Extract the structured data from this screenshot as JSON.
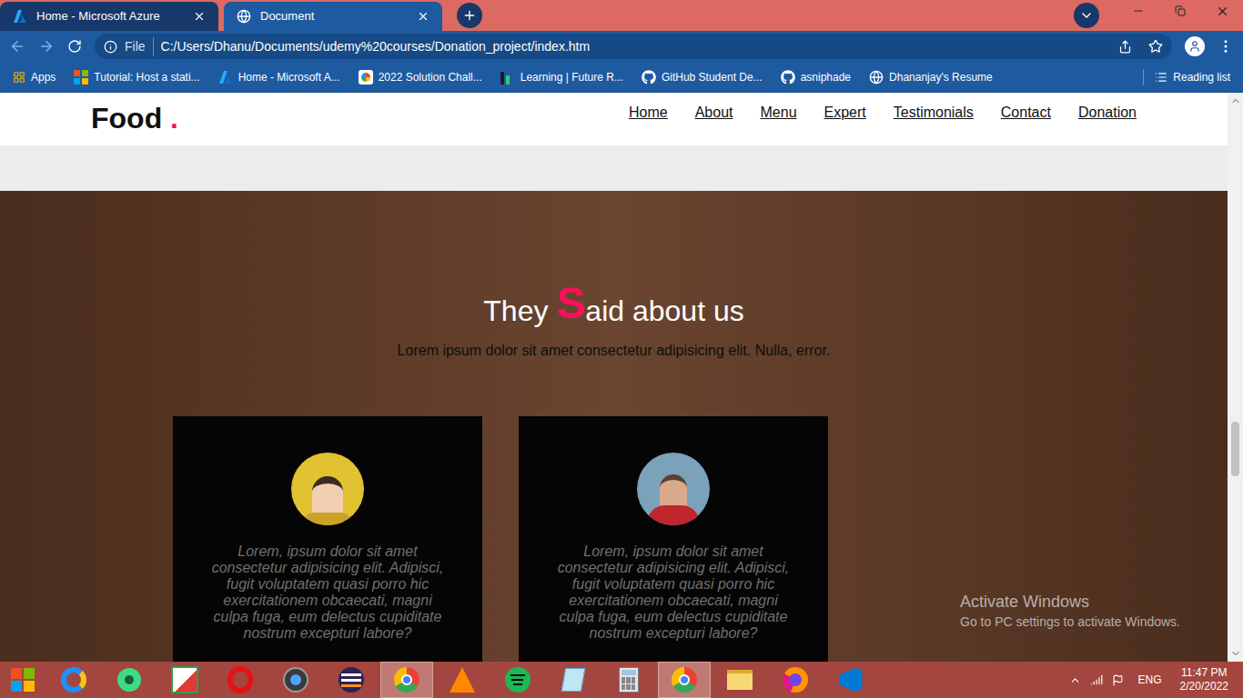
{
  "window": {
    "tabs": [
      {
        "title": "Home - Microsoft Azure",
        "kind": "azure",
        "selected": false
      },
      {
        "title": "Document",
        "kind": "globe",
        "selected": true
      }
    ]
  },
  "address_bar": {
    "scheme": "File",
    "url": "C:/Users/Dhanu/Documents/udemy%20courses/Donation_project/index.htm"
  },
  "bookmarks": {
    "apps": "Apps",
    "items": [
      {
        "label": "Tutorial: Host a stati...",
        "kind": "windows"
      },
      {
        "label": "Home - Microsoft A...",
        "kind": "azure"
      },
      {
        "label": "2022 Solution Chall...",
        "kind": "google"
      },
      {
        "label": "Learning | Future R...",
        "kind": "learning"
      },
      {
        "label": "GitHub Student De...",
        "kind": "github"
      },
      {
        "label": "asniphade",
        "kind": "github"
      },
      {
        "label": "Dhananjay's Resume",
        "kind": "globe"
      }
    ],
    "reading_list": "Reading list"
  },
  "page": {
    "logo": {
      "text": "Food",
      "accent": "."
    },
    "nav": [
      "Home",
      "About",
      "Menu",
      "Expert",
      "Testimonials",
      "Contact",
      "Donation"
    ],
    "section": {
      "title_before": "They ",
      "title_accent": "S",
      "title_after": "aid about us",
      "subtitle": "Lorem ipsum dolor sit amet consectetur adipisicing elit. Nulla, error."
    },
    "testimonials": [
      {
        "avatar": "woman",
        "text": "Lorem, ipsum dolor sit amet consectetur adipisicing elit. Adipisci, fugit voluptatem quasi porro hic exercitationem obcaecati, magni culpa fuga, eum delectus cupiditate nostrum excepturi labore?"
      },
      {
        "avatar": "man",
        "text": "Lorem, ipsum dolor sit amet consectetur adipisicing elit. Adipisci, fugit voluptatem quasi porro hic exercitationem obcaecati, magni culpa fuga, eum delectus cupiditate nostrum excepturi labore?"
      }
    ],
    "scroll": {
      "level": 0.62
    }
  },
  "watermark": {
    "title": "Activate Windows",
    "text": "Go to PC settings to activate Windows."
  },
  "taskbar": {
    "apps": [
      {
        "kind": "ie",
        "selected": false
      },
      {
        "kind": "maps",
        "selected": false
      },
      {
        "kind": "shree",
        "selected": false
      },
      {
        "kind": "opera",
        "selected": false
      },
      {
        "kind": "camera",
        "selected": false
      },
      {
        "kind": "eclipse",
        "selected": false
      },
      {
        "kind": "chrome",
        "selected": true
      },
      {
        "kind": "vlc",
        "selected": false
      },
      {
        "kind": "spotify",
        "selected": false
      },
      {
        "kind": "notes",
        "selected": false
      },
      {
        "kind": "calculator",
        "selected": false
      },
      {
        "kind": "chrome",
        "selected": true
      },
      {
        "kind": "explorer",
        "selected": false
      },
      {
        "kind": "firefox",
        "selected": false
      },
      {
        "kind": "vscode",
        "selected": false
      }
    ],
    "language": "ENG",
    "time": "11:47 PM",
    "date": "2/20/2022"
  }
}
